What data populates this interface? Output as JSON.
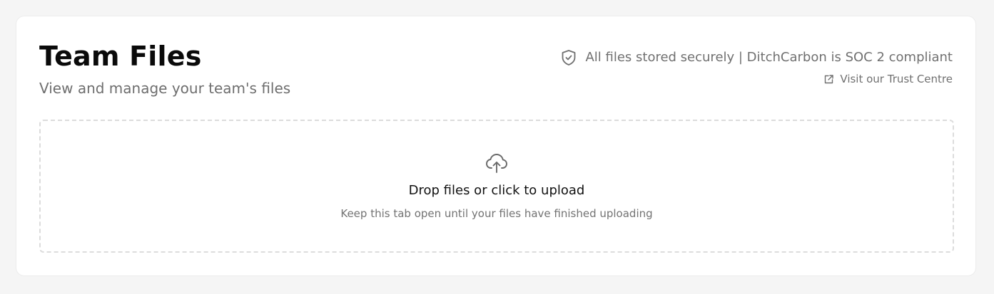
{
  "page": {
    "title": "Team Files",
    "subtitle": "View and manage your team's files"
  },
  "security": {
    "icon": "shield-check-icon",
    "text": "All files stored securely | DitchCarbon is SOC 2 compliant",
    "trust_link_icon": "external-link-icon",
    "trust_link_label": "Visit our Trust Centre"
  },
  "upload": {
    "icon": "cloud-upload-icon",
    "title": "Drop files or click to upload",
    "hint": "Keep this tab open until your files have finished uploading"
  },
  "colors": {
    "background": "#f5f5f5",
    "card": "#ffffff",
    "title": "#0a0a0a",
    "muted_text": "#707070",
    "dashed_border": "#dcdcdc"
  }
}
